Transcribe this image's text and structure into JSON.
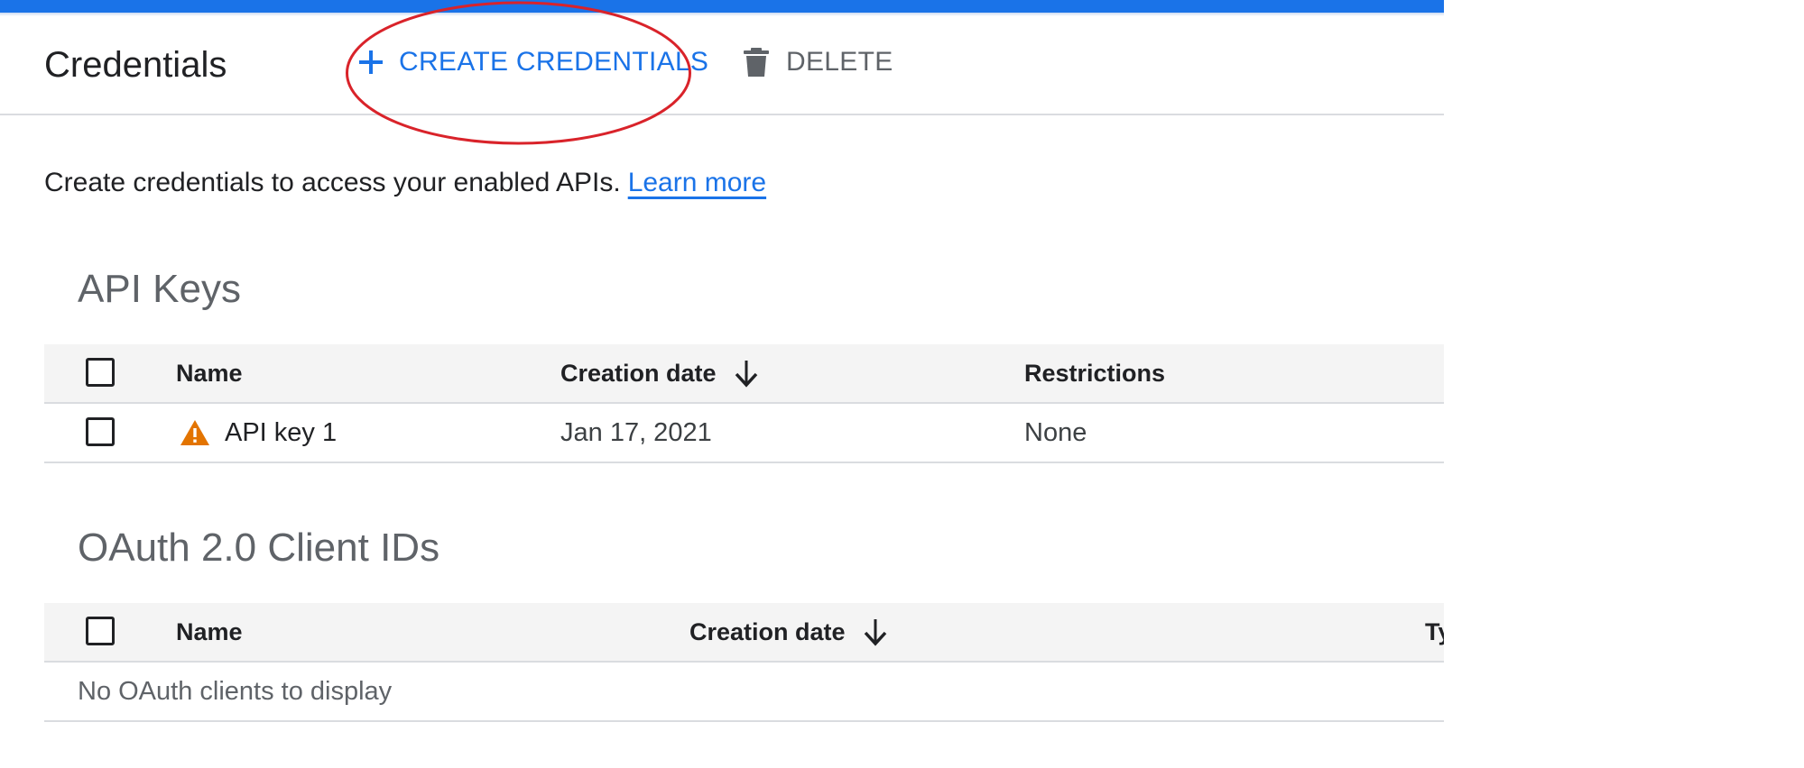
{
  "header": {
    "title": "Credentials",
    "create_label": "CREATE CREDENTIALS",
    "delete_label": "DELETE"
  },
  "intro": {
    "text": "Create credentials to access your enabled APIs.",
    "learn_more": "Learn more"
  },
  "api_keys": {
    "title": "API Keys",
    "columns": {
      "name": "Name",
      "creation_date": "Creation date",
      "restrictions": "Restrictions"
    },
    "rows": [
      {
        "name": "API key 1",
        "creation_date": "Jan 17, 2021",
        "restrictions": "None",
        "status_icon": "warning-icon"
      }
    ]
  },
  "oauth": {
    "title": "OAuth 2.0 Client IDs",
    "columns": {
      "name": "Name",
      "creation_date": "Creation date",
      "type": "Ty"
    },
    "empty_text": "No OAuth clients to display"
  },
  "colors": {
    "accent": "#1a73e8",
    "warning": "#e37400",
    "annotation": "#d9232a"
  }
}
